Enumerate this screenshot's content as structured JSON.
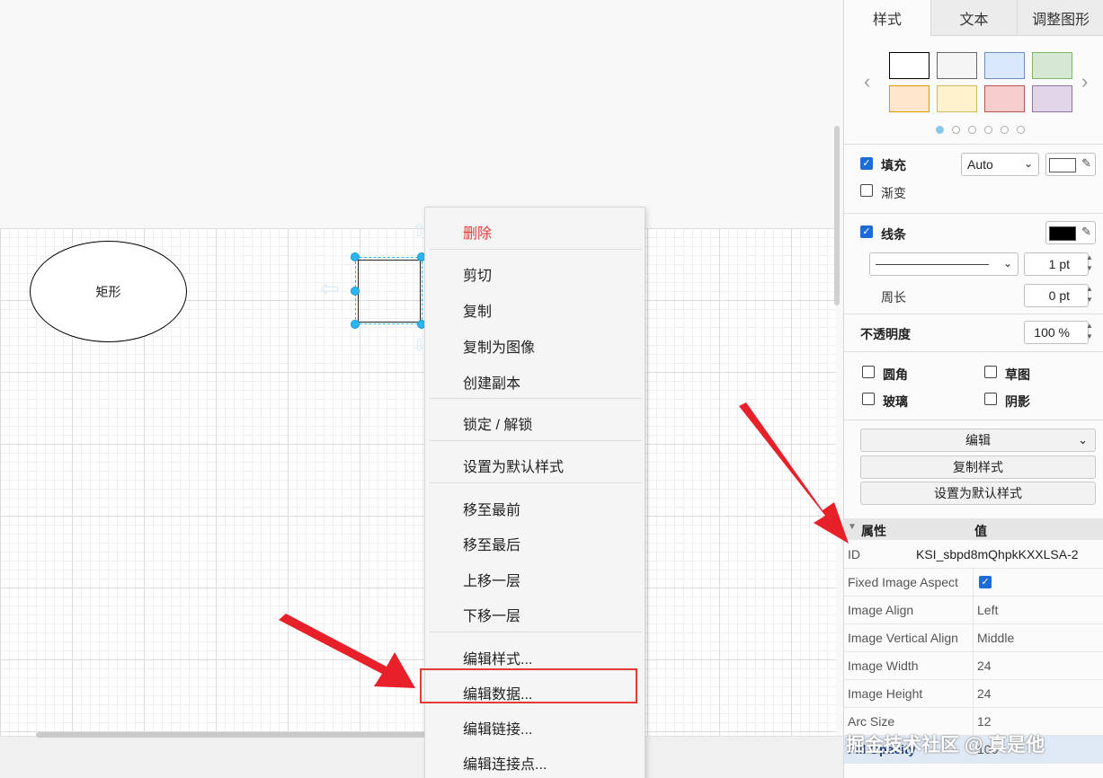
{
  "canvas": {
    "ellipse_label": "矩形"
  },
  "context_menu": {
    "items": [
      {
        "label": "删除"
      },
      {
        "label": "剪切"
      },
      {
        "label": "复制"
      },
      {
        "label": "复制为图像"
      },
      {
        "label": "创建副本"
      },
      {
        "label": "锁定 / 解锁"
      },
      {
        "label": "设置为默认样式"
      },
      {
        "label": "移至最前"
      },
      {
        "label": "移至最后"
      },
      {
        "label": "上移一层"
      },
      {
        "label": "下移一层"
      },
      {
        "label": "编辑样式..."
      },
      {
        "label": "编辑数据..."
      },
      {
        "label": "编辑链接..."
      },
      {
        "label": "编辑连接点..."
      }
    ],
    "highlighted_item": "编辑数据...",
    "danger_color": "#e53935"
  },
  "panel": {
    "tabs": [
      "样式",
      "文本",
      "调整图形"
    ],
    "active_tab": "样式",
    "swatches": [
      "#ffffff",
      "#f5f5f5",
      "#dae8fc",
      "#d5e8d4",
      "#ffe6cc",
      "#fff2cc",
      "#f8cecc",
      "#e1d5e7"
    ],
    "swatch_borders": [
      "#000000",
      "#666666",
      "#6c8ebf",
      "#82b366",
      "#d79b00",
      "#d6b656",
      "#b85450",
      "#9673a6"
    ],
    "page_dots": 6,
    "fill": {
      "label": "填充",
      "checked": true,
      "mode": "Auto",
      "color": "#ffffff"
    },
    "gradient": {
      "label": "渐变",
      "checked": false
    },
    "stroke": {
      "label": "线条",
      "checked": true,
      "color": "#000000",
      "width": "1 pt"
    },
    "perimeter": {
      "label": "周长",
      "value": "0 pt"
    },
    "opacity": {
      "label": "不透明度",
      "value": "100 %"
    },
    "options": [
      {
        "label": "圆角",
        "checked": false
      },
      {
        "label": "草图",
        "checked": false
      },
      {
        "label": "玻璃",
        "checked": false
      },
      {
        "label": "阴影",
        "checked": false
      }
    ],
    "edit_select": "编辑",
    "copy_style": "复制样式",
    "set_default": "设置为默认样式",
    "properties": {
      "header_key": "属性",
      "header_value": "值",
      "rows": [
        {
          "key": "ID",
          "value": "KSI_sbpd8mQhpkKXXLSA-2"
        },
        {
          "key": "Fixed Image Aspect",
          "value": ""
        },
        {
          "key": "Image Align",
          "value": "Left"
        },
        {
          "key": "Image Vertical Align",
          "value": "Middle"
        },
        {
          "key": "Image Width",
          "value": "24"
        },
        {
          "key": "Image Height",
          "value": "24"
        },
        {
          "key": "Arc Size",
          "value": "12"
        },
        {
          "key": "Fill Opacity",
          "value": "100"
        }
      ],
      "fixed_image_aspect_checked": true
    }
  },
  "watermark": "掘金技术社区 @ 真是他",
  "accent_color": "#29b6f2",
  "annotation_color": "#e53935"
}
